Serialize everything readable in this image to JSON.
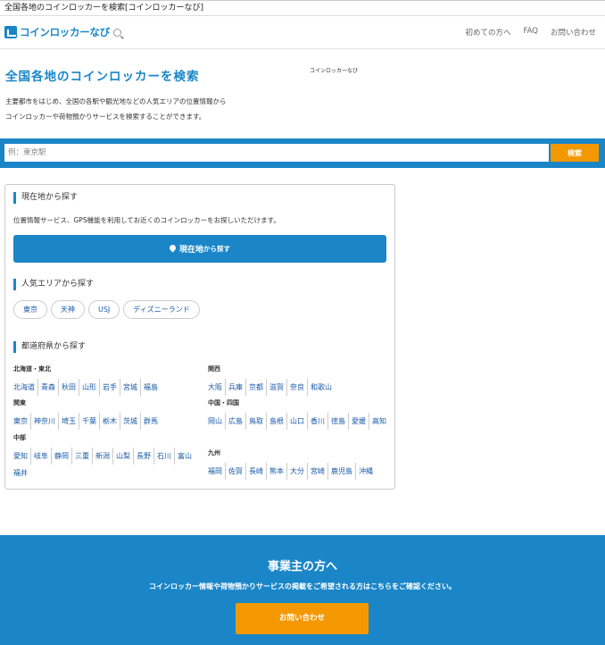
{
  "window": {
    "title": "全国各地のコインロッカーを検索[コインロッカーなび]"
  },
  "header": {
    "logo_text": "コインロッカーなび",
    "nav": [
      "初めての方へ",
      "FAQ",
      "お問い合わせ"
    ]
  },
  "hero": {
    "title": "全国各地のコインロッカーを検索",
    "side_label": "コインロッカーなび",
    "desc_line1": "主要都市をはじめ、全国の各駅や観光地などの人気エリアの位置情報から",
    "desc_line2": "コインロッカーや荷物預かりサービスを検索することができます。"
  },
  "search": {
    "placeholder": "例：東京駅",
    "button": "検索"
  },
  "current_location": {
    "heading": "現在地から探す",
    "desc": "位置情報サービス、GPS機能を利用してお近くのコインロッカーをお探しいただけます。",
    "button_main": "現在地",
    "button_sub": "から探す"
  },
  "popular": {
    "heading": "人気エリアから探す",
    "areas": [
      "東京",
      "天神",
      "USJ",
      "ディズニーランド"
    ]
  },
  "prefectures": {
    "heading": "都道府県から探す",
    "regions": [
      {
        "name": "北海道・東北",
        "prefs": [
          "北海道",
          "青森",
          "秋田",
          "山形",
          "岩手",
          "宮城",
          "福島"
        ]
      },
      {
        "name": "関東",
        "prefs": [
          "東京",
          "神奈川",
          "埼玉",
          "千葉",
          "栃木",
          "茨城",
          "群馬"
        ]
      },
      {
        "name": "中部",
        "prefs": [
          "愛知",
          "岐阜",
          "静岡",
          "三重",
          "新潟",
          "山梨",
          "長野",
          "石川",
          "富山",
          "福井"
        ]
      },
      {
        "name": "関西",
        "prefs": [
          "大阪",
          "兵庫",
          "京都",
          "滋賀",
          "奈良",
          "和歌山"
        ]
      },
      {
        "name": "中国・四国",
        "prefs": [
          "岡山",
          "広島",
          "鳥取",
          "島根",
          "山口",
          "香川",
          "徳島",
          "愛媛",
          "高知"
        ]
      },
      {
        "name": "九州",
        "prefs": [
          "福岡",
          "佐賀",
          "長崎",
          "熊本",
          "大分",
          "宮崎",
          "鹿児島",
          "沖縄"
        ]
      }
    ]
  },
  "business": {
    "title": "事業主の方へ",
    "desc": "コインロッカー情報や荷物預かりサービスの掲載をご希望される方はこちらをご確認ください。",
    "button": "お問い合わせ"
  },
  "colors": {
    "primary": "#1a86c8",
    "accent": "#f39800",
    "link": "#1a5aa8"
  }
}
